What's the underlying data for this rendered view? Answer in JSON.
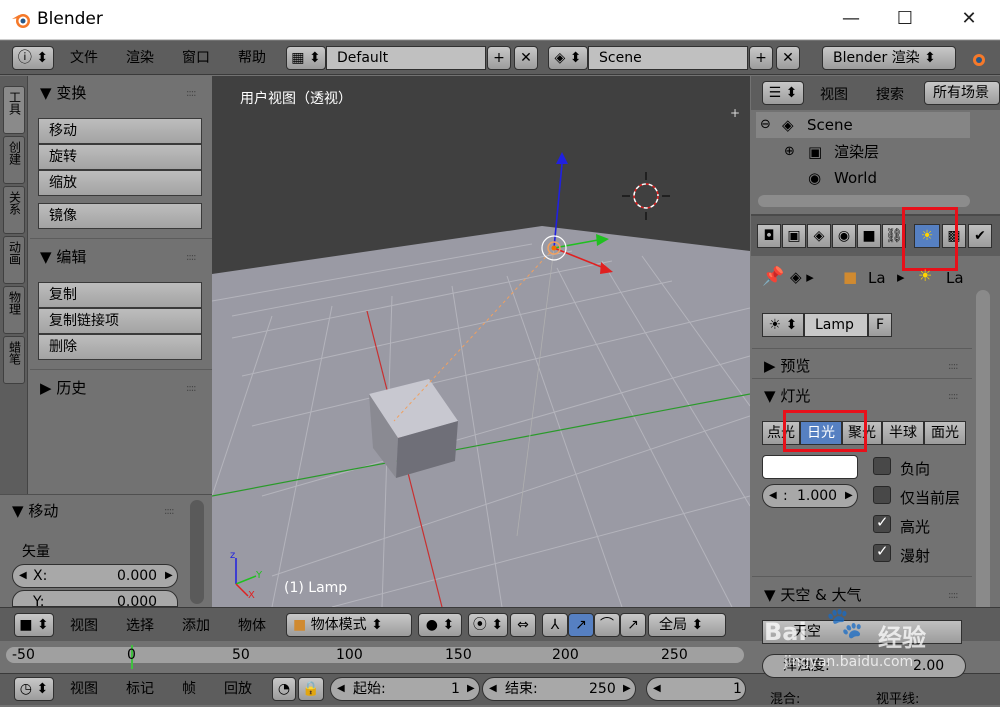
{
  "window": {
    "title": "Blender",
    "minimize": "—",
    "maximize": "☐",
    "close": "✕"
  },
  "infobar": {
    "menus": [
      "文件",
      "渲染",
      "窗口",
      "帮助"
    ],
    "screen_layout": "Default",
    "scene": "Scene",
    "render_engine": "Blender 渲染"
  },
  "tabs": [
    "工具",
    "创建",
    "关系",
    "动画",
    "物理",
    "蜡笔"
  ],
  "toolshelf": {
    "transform_header": "变换",
    "transform_buttons": [
      "移动",
      "旋转",
      "缩放"
    ],
    "mirror_button": "镜像",
    "edit_header": "编辑",
    "edit_buttons": [
      "复制",
      "复制链接项",
      "删除"
    ],
    "history_header": "历史",
    "operator_header": "移动",
    "vector_label": "矢量",
    "x_label": "X:",
    "x_value": "0.000",
    "y_label": "Y:",
    "y_value": "0.000"
  },
  "viewport": {
    "view_label": "用户视图（透视）",
    "object_label": "(1) Lamp"
  },
  "outliner": {
    "view": "视图",
    "search": "搜索",
    "filter": "所有场景",
    "rows": [
      "Scene",
      "渲染层",
      "World"
    ]
  },
  "properties": {
    "breadcrumb_obj": "La",
    "breadcrumb_data": "La",
    "datablock_name": "Lamp",
    "fake_user": "F",
    "preview_header": "预览",
    "lamp_header": "灯光",
    "lamp_types": [
      "点光",
      "日光",
      "聚光",
      "半球",
      "面光"
    ],
    "active_lamp_type": "日光",
    "energy_label": ":",
    "energy_value": "1.000",
    "options": [
      {
        "label": "负向",
        "checked": false
      },
      {
        "label": "仅当前层",
        "checked": false
      },
      {
        "label": "高光",
        "checked": true
      },
      {
        "label": "漫射",
        "checked": true
      }
    ],
    "sky_header": "天空 & 大气",
    "sky_label": "天空",
    "turbidity_label": "浑浊度:",
    "turbidity_value": "2.00",
    "blend_label": "混合:",
    "horizon_label": "视平线:"
  },
  "viewport_header": {
    "menus": [
      "视图",
      "选择",
      "添加",
      "物体"
    ],
    "mode": "物体模式",
    "orientation": "全局"
  },
  "timeline": {
    "ticks": [
      "-50",
      "0",
      "50",
      "100",
      "150",
      "200",
      "250"
    ]
  },
  "bottom": {
    "menus": [
      "视图",
      "标记",
      "帧",
      "回放"
    ],
    "start_label": "起始:",
    "start_value": "1",
    "end_label": "结束:",
    "end_value": "250",
    "current_frame": "1"
  },
  "watermark": {
    "logo": "Bai",
    "brand": "经验",
    "url": "jingyan.baidu.com"
  },
  "colors": {
    "highlight": "#e8101a",
    "active": "#5680c2"
  }
}
